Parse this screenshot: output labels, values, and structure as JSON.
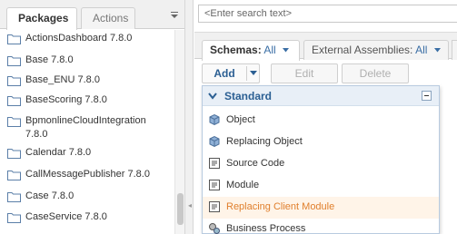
{
  "left_tabs": {
    "active": "Packages",
    "inactive": "Actions"
  },
  "packages": [
    "ActionsDashboard 7.8.0",
    "Base 7.8.0",
    "Base_ENU 7.8.0",
    "BaseScoring 7.8.0",
    "BpmonlineCloudIntegration 7.8.0",
    "Calendar 7.8.0",
    "CallMessagePublisher 7.8.0",
    "Case 7.8.0",
    "CaseService 7.8.0"
  ],
  "search": {
    "placeholder": "<Enter search text>"
  },
  "right_tabs": {
    "schemas": {
      "label": "Schemas:",
      "value": "All"
    },
    "assemblies": {
      "label": "External Assemblies:",
      "value": "All"
    }
  },
  "toolbar": {
    "add": "Add",
    "edit": "Edit",
    "delete": "Delete"
  },
  "dropdown": {
    "section_title": "Standard",
    "items": [
      {
        "label": "Object",
        "icon": "object-icon"
      },
      {
        "label": "Replacing Object",
        "icon": "replacing-object-icon"
      },
      {
        "label": "Source Code",
        "icon": "source-code-icon"
      },
      {
        "label": "Module",
        "icon": "module-icon"
      },
      {
        "label": "Replacing Client Module",
        "icon": "replacing-client-module-icon"
      },
      {
        "label": "Business Process",
        "icon": "business-process-icon"
      }
    ]
  },
  "colors": {
    "accent": "#2b5f93",
    "hover_text": "#e07f2c",
    "hover_bg": "#fff4e8",
    "header_bg": "#e8eff7"
  }
}
